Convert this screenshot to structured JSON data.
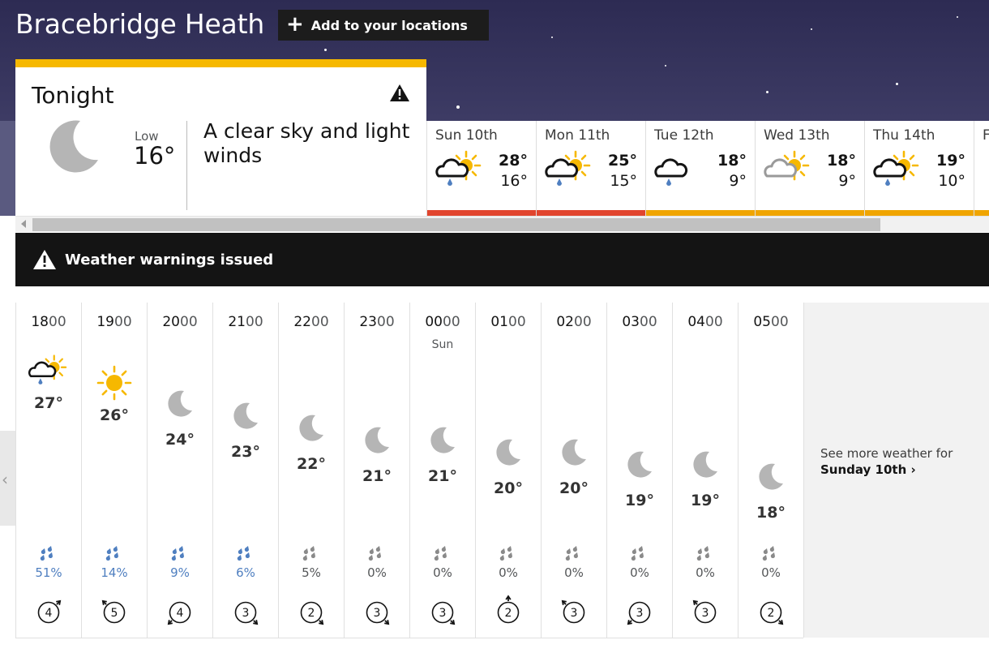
{
  "location": {
    "name": "Bracebridge Heath",
    "add_label": "Add to your locations"
  },
  "tonight": {
    "title": "Tonight",
    "low_label": "Low",
    "low_value": "16°",
    "description": "A clear sky and light winds"
  },
  "days": [
    {
      "name": "Sun 10th",
      "high": "28°",
      "low": "16°",
      "icon": "sun-cloud-rain-icon",
      "bar_color": "#e1452e"
    },
    {
      "name": "Mon 11th",
      "high": "25°",
      "low": "15°",
      "icon": "sun-cloud-rain-icon",
      "bar_color": "#e1452e"
    },
    {
      "name": "Tue 12th",
      "high": "18°",
      "low": "9°",
      "icon": "cloud-rain-icon",
      "bar_color": "#f0a500"
    },
    {
      "name": "Wed 13th",
      "high": "18°",
      "low": "9°",
      "icon": "sun-grey-cloud-icon",
      "bar_color": "#f0a500"
    },
    {
      "name": "Thu 14th",
      "high": "19°",
      "low": "10°",
      "icon": "sun-cloud-rain-icon",
      "bar_color": "#f0a500"
    },
    {
      "name": "F",
      "high": "",
      "low": "",
      "icon": "",
      "bar_color": "#f0a500"
    }
  ],
  "warnings": {
    "label": "Weather warnings issued"
  },
  "hours": [
    {
      "hh": "18",
      "mm": "00",
      "day": "",
      "icon": "sun-cloud-rain-icon",
      "temp": "27°",
      "chance": "51%",
      "wet": true,
      "wind": "4",
      "dir": "northeast"
    },
    {
      "hh": "19",
      "mm": "00",
      "day": "",
      "icon": "sun-icon",
      "temp": "26°",
      "chance": "14%",
      "wet": true,
      "wind": "5",
      "dir": "northwest"
    },
    {
      "hh": "20",
      "mm": "00",
      "day": "",
      "icon": "moon-icon",
      "temp": "24°",
      "chance": "9%",
      "wet": true,
      "wind": "4",
      "dir": "southwest"
    },
    {
      "hh": "21",
      "mm": "00",
      "day": "",
      "icon": "moon-icon",
      "temp": "23°",
      "chance": "6%",
      "wet": true,
      "wind": "3",
      "dir": "southeast"
    },
    {
      "hh": "22",
      "mm": "00",
      "day": "",
      "icon": "moon-icon",
      "temp": "22°",
      "chance": "5%",
      "wet": false,
      "wind": "2",
      "dir": "southeast"
    },
    {
      "hh": "23",
      "mm": "00",
      "day": "",
      "icon": "moon-icon",
      "temp": "21°",
      "chance": "0%",
      "wet": false,
      "wind": "3",
      "dir": "southeast"
    },
    {
      "hh": "00",
      "mm": "00",
      "day": "Sun",
      "icon": "moon-icon",
      "temp": "21°",
      "chance": "0%",
      "wet": false,
      "wind": "3",
      "dir": "southeast"
    },
    {
      "hh": "01",
      "mm": "00",
      "day": "",
      "icon": "moon-icon",
      "temp": "20°",
      "chance": "0%",
      "wet": false,
      "wind": "2",
      "dir": "north"
    },
    {
      "hh": "02",
      "mm": "00",
      "day": "",
      "icon": "moon-icon",
      "temp": "20°",
      "chance": "0%",
      "wet": false,
      "wind": "3",
      "dir": "northwest"
    },
    {
      "hh": "03",
      "mm": "00",
      "day": "",
      "icon": "moon-icon",
      "temp": "19°",
      "chance": "0%",
      "wet": false,
      "wind": "3",
      "dir": "southwest"
    },
    {
      "hh": "04",
      "mm": "00",
      "day": "",
      "icon": "moon-icon",
      "temp": "19°",
      "chance": "0%",
      "wet": false,
      "wind": "3",
      "dir": "northwest"
    },
    {
      "hh": "05",
      "mm": "00",
      "day": "",
      "icon": "moon-icon",
      "temp": "18°",
      "chance": "0%",
      "wet": false,
      "wind": "2",
      "dir": "southeast"
    }
  ],
  "see_more": {
    "line1": "See more weather for",
    "line2": "Sunday 10th"
  },
  "colors": {
    "accent": "#f6b800",
    "rain_blue": "#4f7fc0",
    "dry_grey": "#8a8a8a",
    "moon_grey": "#b5b5b5"
  }
}
